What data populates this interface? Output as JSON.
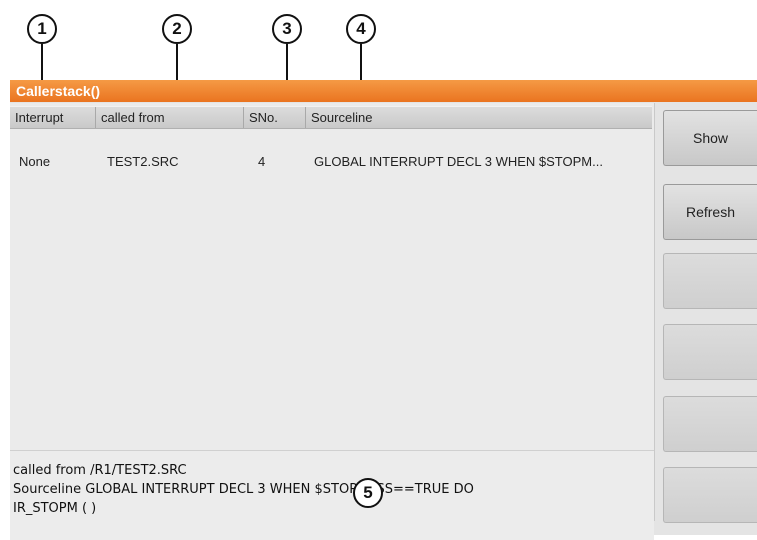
{
  "callouts": [
    "1",
    "2",
    "3",
    "4",
    "5"
  ],
  "window": {
    "title": "Callerstack()"
  },
  "table": {
    "columns": [
      "Interrupt",
      "called from",
      "SNo.",
      "Sourceline"
    ],
    "rows": [
      {
        "interrupt": "None",
        "called_from": "TEST2.SRC",
        "sno": "4",
        "sourceline": "GLOBAL INTERRUPT DECL 3 WHEN $STOPM..."
      }
    ]
  },
  "detail": {
    "line1": "called from /R1/TEST2.SRC",
    "line2": "Sourceline GLOBAL INTERRUPT DECL 3 WHEN $STOPMESS==TRUE DO",
    "line3": "IR_STOPM ( )"
  },
  "softkeys": [
    "Show",
    "Refresh",
    "",
    "",
    "",
    ""
  ],
  "colors": {
    "titlebar": "#ea7420",
    "panel": "#ebebeb"
  }
}
